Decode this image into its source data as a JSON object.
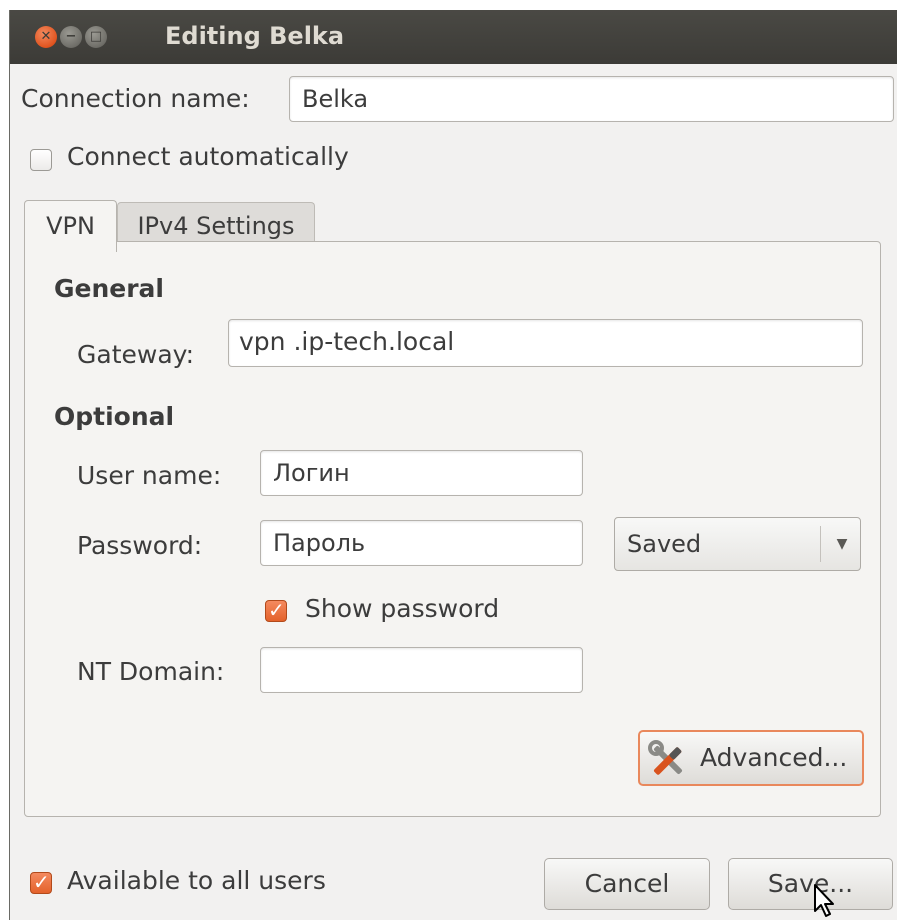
{
  "window": {
    "title": "Editing Belka"
  },
  "connection": {
    "name_label": "Connection name:",
    "name_value": "Belka",
    "auto_connect_label": "Connect automatically",
    "auto_connect_checked": false
  },
  "tabs": [
    {
      "label": "VPN",
      "active": true
    },
    {
      "label": "IPv4 Settings",
      "active": false
    }
  ],
  "vpn": {
    "general_heading": "General",
    "gateway_label": "Gateway:",
    "gateway_value": "vpn .ip-tech.local",
    "optional_heading": "Optional",
    "username_label": "User name:",
    "username_value": "Логин",
    "password_label": "Password:",
    "password_value": "Пароль",
    "password_storage": "Saved",
    "show_password_label": "Show password",
    "show_password_checked": true,
    "nt_domain_label": "NT Domain:",
    "nt_domain_value": "",
    "advanced_label": "Advanced..."
  },
  "footer": {
    "all_users_label": "Available to all users",
    "all_users_checked": true,
    "cancel_label": "Cancel",
    "save_label": "Save..."
  },
  "icons": {
    "window_close": "close-icon",
    "window_minimize": "minimize-icon",
    "window_maximize": "maximize-icon",
    "advanced": "tools-icon",
    "dropdown": "chevron-down-icon",
    "cursor": "mouse-pointer-icon"
  },
  "colors": {
    "accent": "#e4622b",
    "titlebar": "#3c3b37",
    "window_bg": "#f2f1f0"
  }
}
